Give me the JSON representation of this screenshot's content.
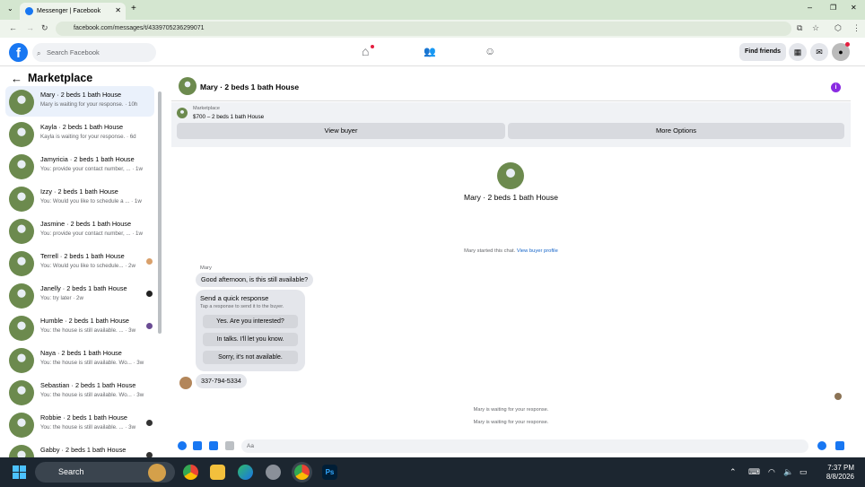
{
  "browser": {
    "tab_title": "Messenger | Facebook",
    "url": "facebook.com/messages/t/4339705236299071"
  },
  "fb": {
    "search_placeholder": "Search Facebook",
    "find_friends": "Find friends"
  },
  "sidebar": {
    "title": "Marketplace",
    "conversations": [
      {
        "name": "Mary · 2 beds 1 bath House",
        "preview": "Mary is waiting for your response. · 10h"
      },
      {
        "name": "Kayla · 2 beds 1 bath House",
        "preview": "Kayla is waiting for your response. · 6d"
      },
      {
        "name": "Jamyricia · 2 beds 1 bath House",
        "preview": "You: provide your contact number, ... · 1w"
      },
      {
        "name": "Izzy · 2 beds 1 bath House",
        "preview": "You: Would you like to schedule a ... · 1w"
      },
      {
        "name": "Jasmine · 2 beds 1 bath House",
        "preview": "You: provide your contact number, ... · 1w"
      },
      {
        "name": "Terrell · 2 beds 1 bath House",
        "preview": "You: Would you like to schedule... · 2w"
      },
      {
        "name": "Janelly · 2 beds 1 bath House",
        "preview": "You: try later · 2w"
      },
      {
        "name": "Humble · 2 beds 1 bath House",
        "preview": "You: the house is still available. ... · 3w"
      },
      {
        "name": "Naya · 2 beds 1 bath House",
        "preview": "You: the house is still available. Wo... · 3w"
      },
      {
        "name": "Sebastian · 2 beds 1 bath House",
        "preview": "You: the house is still available. Wo... · 3w"
      },
      {
        "name": "Robbie · 2 beds 1 bath House",
        "preview": "You: the house is still available. ... · 3w"
      },
      {
        "name": "Gabby · 2 beds 1 bath House",
        "preview": ""
      }
    ]
  },
  "chat": {
    "header_name": "Mary · 2 beds 1 bath House",
    "marketplace_label": "Marketplace",
    "listing": "$700 – 2 beds 1 bath House",
    "view_buyer": "View buyer",
    "more_options": "More Options",
    "center_name": "Mary · 2 beds 1 bath House",
    "started_text": "Mary started this chat.",
    "view_profile": "View buyer profile",
    "sender": "Mary",
    "message1": "Good afternoon, is this still available?",
    "quick_title": "Send a quick response",
    "quick_sub": "Tap a response to send it to the buyer.",
    "quick_replies": [
      "Yes. Are you interested?",
      "In talks. I'll let you know.",
      "Sorry, it's not available."
    ],
    "phone": "337-794-5334",
    "waiting1": "Mary is waiting for your response.",
    "waiting2": "Mary is waiting for your response.",
    "composer_placeholder": "Aa"
  },
  "taskbar": {
    "search": "Search",
    "time": "7:37 PM",
    "date": "8/8/2026"
  }
}
